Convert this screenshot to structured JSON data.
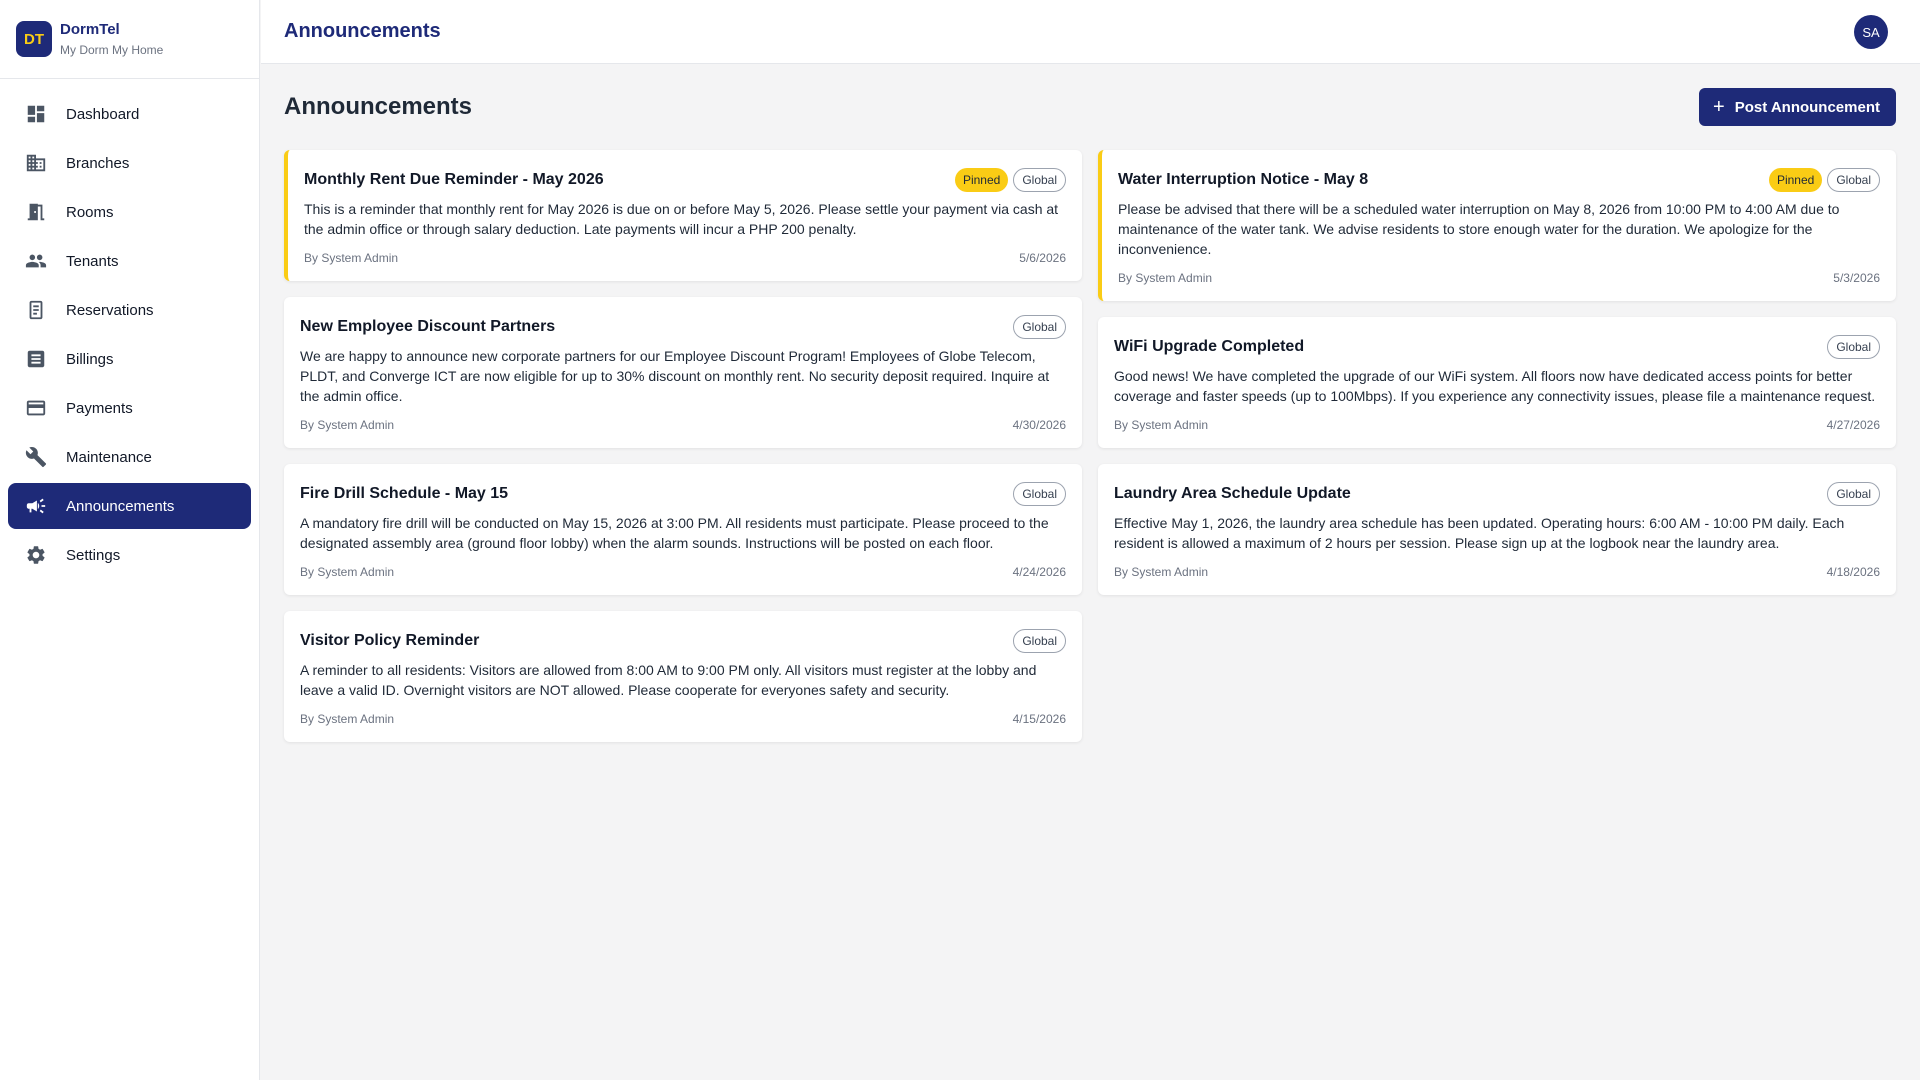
{
  "brand": {
    "logo": "DT",
    "name": "DormTel",
    "tagline": "My Dorm My Home"
  },
  "sidebar": {
    "items": [
      {
        "label": "Dashboard",
        "icon": "dashboard-icon",
        "active": false
      },
      {
        "label": "Branches",
        "icon": "building-icon",
        "active": false
      },
      {
        "label": "Rooms",
        "icon": "door-icon",
        "active": false
      },
      {
        "label": "Tenants",
        "icon": "people-icon",
        "active": false
      },
      {
        "label": "Reservations",
        "icon": "reservation-icon",
        "active": false
      },
      {
        "label": "Billings",
        "icon": "billing-list-icon",
        "active": false
      },
      {
        "label": "Payments",
        "icon": "credit-card-icon",
        "active": false
      },
      {
        "label": "Maintenance",
        "icon": "wrench-icon",
        "active": false
      },
      {
        "label": "Announcements",
        "icon": "megaphone-icon",
        "active": true
      },
      {
        "label": "Settings",
        "icon": "gear-icon",
        "active": false
      }
    ]
  },
  "topbar": {
    "title": "Announcements",
    "avatar": "SA"
  },
  "page": {
    "title": "Announcements",
    "post_button": "Post Announcement",
    "post_button_icon": "plus-icon"
  },
  "badges": {
    "pinned": "Pinned",
    "global": "Global"
  },
  "colors": {
    "primary": "#1e2a78",
    "pinned": "#facc15",
    "background": "#f4f4f5"
  },
  "announcements": [
    {
      "title": "Monthly Rent Due Reminder - May 2026",
      "pinned": true,
      "scope": "Global",
      "body": "This is a reminder that monthly rent for May 2026 is due on or before May 5, 2026. Please settle your payment via cash at the admin office or through salary deduction. Late payments will incur a PHP 200 penalty.",
      "author": "By System Admin",
      "date": "5/6/2026"
    },
    {
      "title": "Water Interruption Notice - May 8",
      "pinned": true,
      "scope": "Global",
      "body": "Please be advised that there will be a scheduled water interruption on May 8, 2026 from 10:00 PM to 4:00 AM due to maintenance of the water tank. We advise residents to store enough water for the duration. We apologize for the inconvenience.",
      "author": "By System Admin",
      "date": "5/3/2026"
    },
    {
      "title": "New Employee Discount Partners",
      "pinned": false,
      "scope": "Global",
      "body": "We are happy to announce new corporate partners for our Employee Discount Program! Employees of Globe Telecom, PLDT, and Converge ICT are now eligible for up to 30% discount on monthly rent. No security deposit required. Inquire at the admin office.",
      "author": "By System Admin",
      "date": "4/30/2026"
    },
    {
      "title": "WiFi Upgrade Completed",
      "pinned": false,
      "scope": "Global",
      "body": "Good news! We have completed the upgrade of our WiFi system. All floors now have dedicated access points for better coverage and faster speeds (up to 100Mbps). If you experience any connectivity issues, please file a maintenance request.",
      "author": "By System Admin",
      "date": "4/27/2026"
    },
    {
      "title": "Fire Drill Schedule - May 15",
      "pinned": false,
      "scope": "Global",
      "body": "A mandatory fire drill will be conducted on May 15, 2026 at 3:00 PM. All residents must participate. Please proceed to the designated assembly area (ground floor lobby) when the alarm sounds. Instructions will be posted on each floor.",
      "author": "By System Admin",
      "date": "4/24/2026"
    },
    {
      "title": "Laundry Area Schedule Update",
      "pinned": false,
      "scope": "Global",
      "body": "Effective May 1, 2026, the laundry area schedule has been updated. Operating hours: 6:00 AM - 10:00 PM daily. Each resident is allowed a maximum of 2 hours per session. Please sign up at the logbook near the laundry area.",
      "author": "By System Admin",
      "date": "4/18/2026"
    },
    {
      "title": "Visitor Policy Reminder",
      "pinned": false,
      "scope": "Global",
      "body": "A reminder to all residents: Visitors are allowed from 8:00 AM to 9:00 PM only. All visitors must register at the lobby and leave a valid ID. Overnight visitors are NOT allowed. Please cooperate for everyones safety and security.",
      "author": "By System Admin",
      "date": "4/15/2026"
    }
  ]
}
